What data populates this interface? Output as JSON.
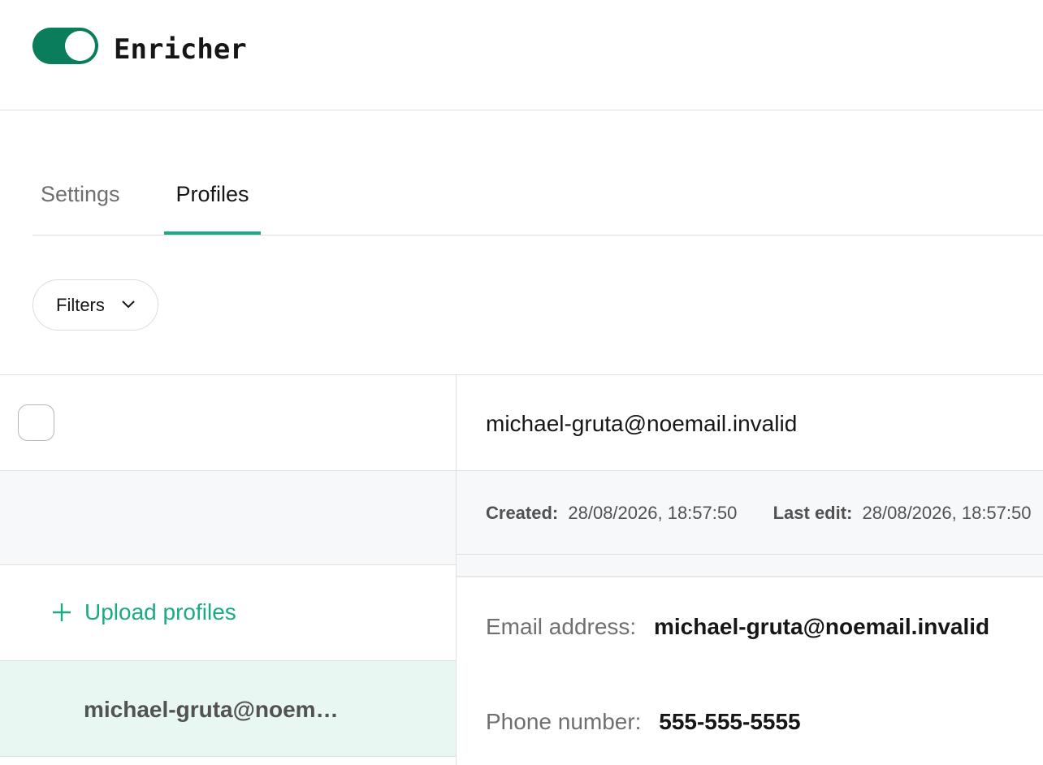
{
  "app": {
    "title": "Enricher",
    "enabled": true
  },
  "tabs": [
    {
      "label": "Settings",
      "active": false
    },
    {
      "label": "Profiles",
      "active": true
    }
  ],
  "filters": {
    "label": "Filters"
  },
  "list": {
    "upload_label": "Upload profiles",
    "items": [
      {
        "label": "michael-gruta@noemail.invalid",
        "selected": true
      }
    ]
  },
  "detail": {
    "title": "michael-gruta@noemail.invalid",
    "meta": {
      "created_label": "Created:",
      "created_value": "28/08/2026, 18:57:50",
      "last_edit_label": "Last edit:",
      "last_edit_value": "28/08/2026, 18:57:50"
    },
    "fields": {
      "email_label": "Email address:",
      "email_value": "michael-gruta@noemail.invalid",
      "phone_label": "Phone number:",
      "phone_value": "555-555-5555"
    }
  },
  "colors": {
    "accent": "#1aaa84",
    "toggle_on": "#0a7d5c",
    "selected_row": "#e8f7f2"
  },
  "icons": {
    "filters": "chevron-down-icon",
    "upload": "plus-icon"
  }
}
